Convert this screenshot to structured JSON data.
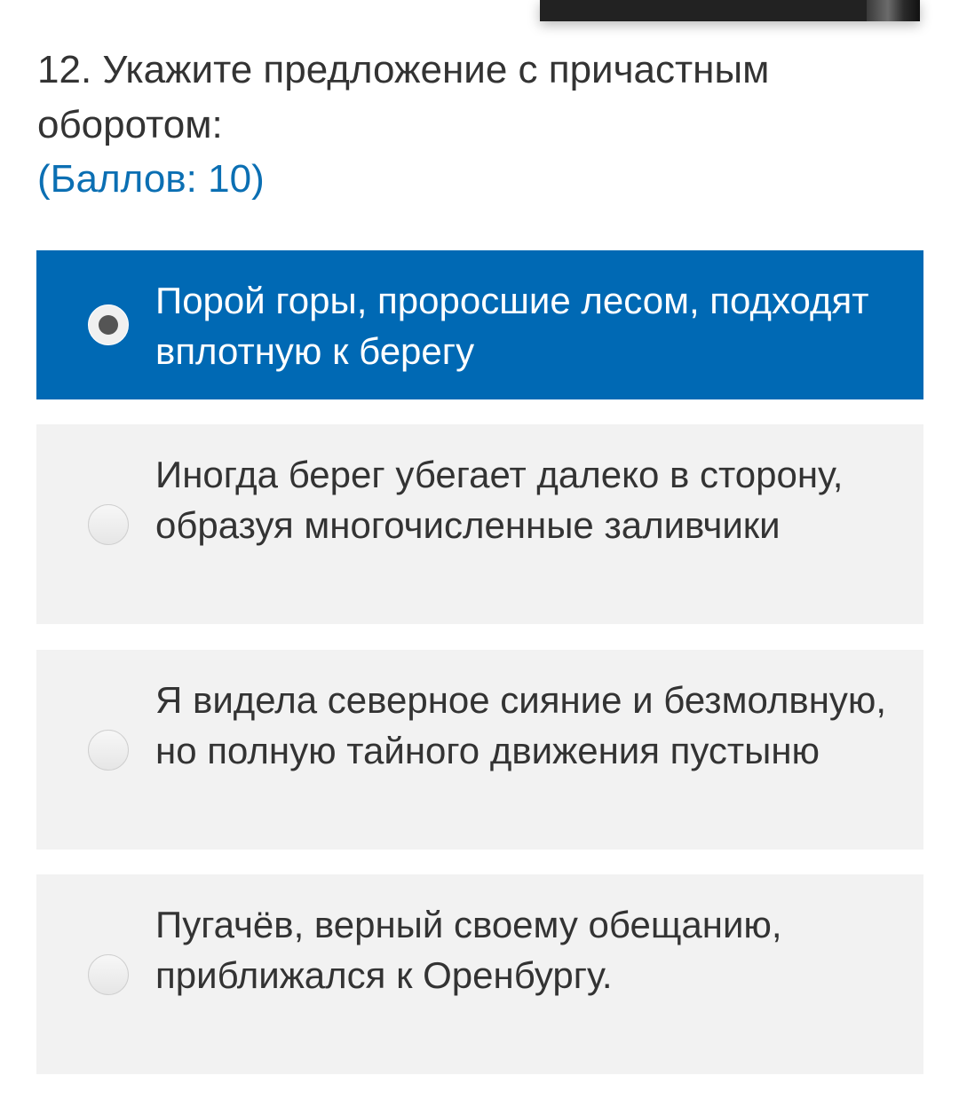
{
  "question": {
    "text": "12. Укажите предложение с причастным оборотом:",
    "points": "(Баллов: 10)"
  },
  "options": [
    {
      "label": "Порой горы, проросшие лесом, подходят вплотную к берегу",
      "selected": true
    },
    {
      "label": "Иногда берег убегает далеко в сторону, образуя многочисленные заливчики",
      "selected": false
    },
    {
      "label": "Я видела северное сияние и безмолвную, но полную тайного движения пустыню",
      "selected": false
    },
    {
      "label": "Пугачёв, верный своему обещанию, приближался к Оренбургу.",
      "selected": false
    }
  ],
  "colors": {
    "accent": "#0069b4",
    "points_text": "#0b6fb3",
    "option_bg": "#f2f2f2",
    "text": "#333333"
  }
}
